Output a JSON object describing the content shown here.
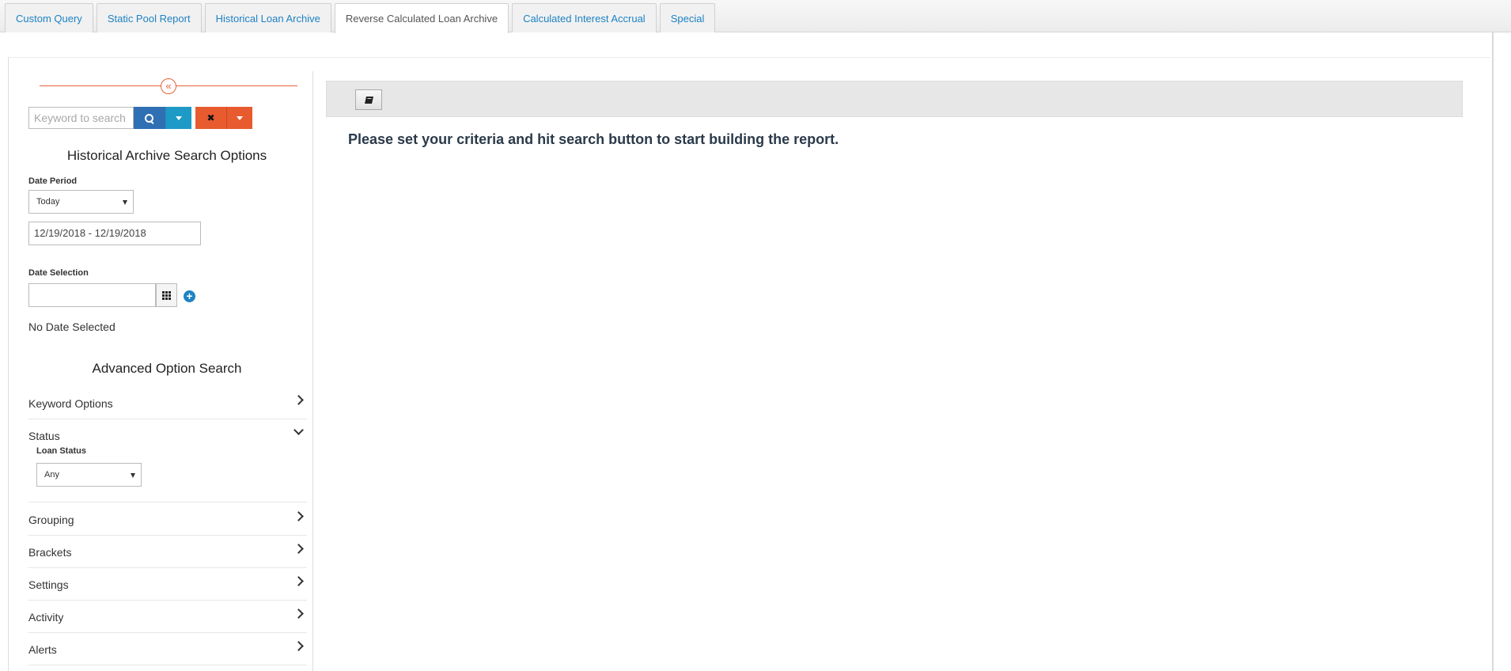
{
  "tabs": [
    {
      "label": "Custom Query"
    },
    {
      "label": "Static Pool Report"
    },
    {
      "label": "Historical Loan Archive"
    },
    {
      "label": "Reverse Calculated Loan Archive"
    },
    {
      "label": "Calculated Interest Accrual"
    },
    {
      "label": "Special"
    }
  ],
  "active_tab": "Reverse Calculated Loan Archive",
  "search": {
    "placeholder": "Keyword to search",
    "value": ""
  },
  "sidebar": {
    "collapse_glyph": "«",
    "section_title": "Historical Archive Search Options",
    "date_period": {
      "label": "Date Period",
      "selected": "Today",
      "range": "12/19/2018 - 12/19/2018"
    },
    "date_selection": {
      "label": "Date Selection",
      "value": "",
      "add_glyph": "+",
      "empty_text": "No Date Selected"
    },
    "advanced": {
      "title": "Advanced Option Search",
      "items": [
        {
          "label": "Keyword Options",
          "expanded": false
        },
        {
          "label": "Status",
          "expanded": true,
          "sub_label": "Loan Status",
          "sub_selected": "Any"
        },
        {
          "label": "Grouping",
          "expanded": false
        },
        {
          "label": "Brackets",
          "expanded": false
        },
        {
          "label": "Settings",
          "expanded": false
        },
        {
          "label": "Activity",
          "expanded": false
        },
        {
          "label": "Alerts",
          "expanded": false
        }
      ]
    }
  },
  "buttons": {
    "clear_glyph": "✖"
  },
  "main": {
    "message": "Please set your criteria and hit search button to start building the report."
  },
  "icons": {
    "collapse": "double-chevron-left-icon",
    "search": "magnifier-icon",
    "clear": "x-icon",
    "calendar": "grid-icon",
    "add": "plus-circle-icon",
    "report": "book-icon"
  },
  "colors": {
    "tab_link": "#1e82c4",
    "search_button": "#2f6fb3",
    "search_dropdown": "#1d9ac6",
    "clear_button": "#e85b2f",
    "accent_line": "#e8613a",
    "message_text": "#2b3a4a"
  }
}
